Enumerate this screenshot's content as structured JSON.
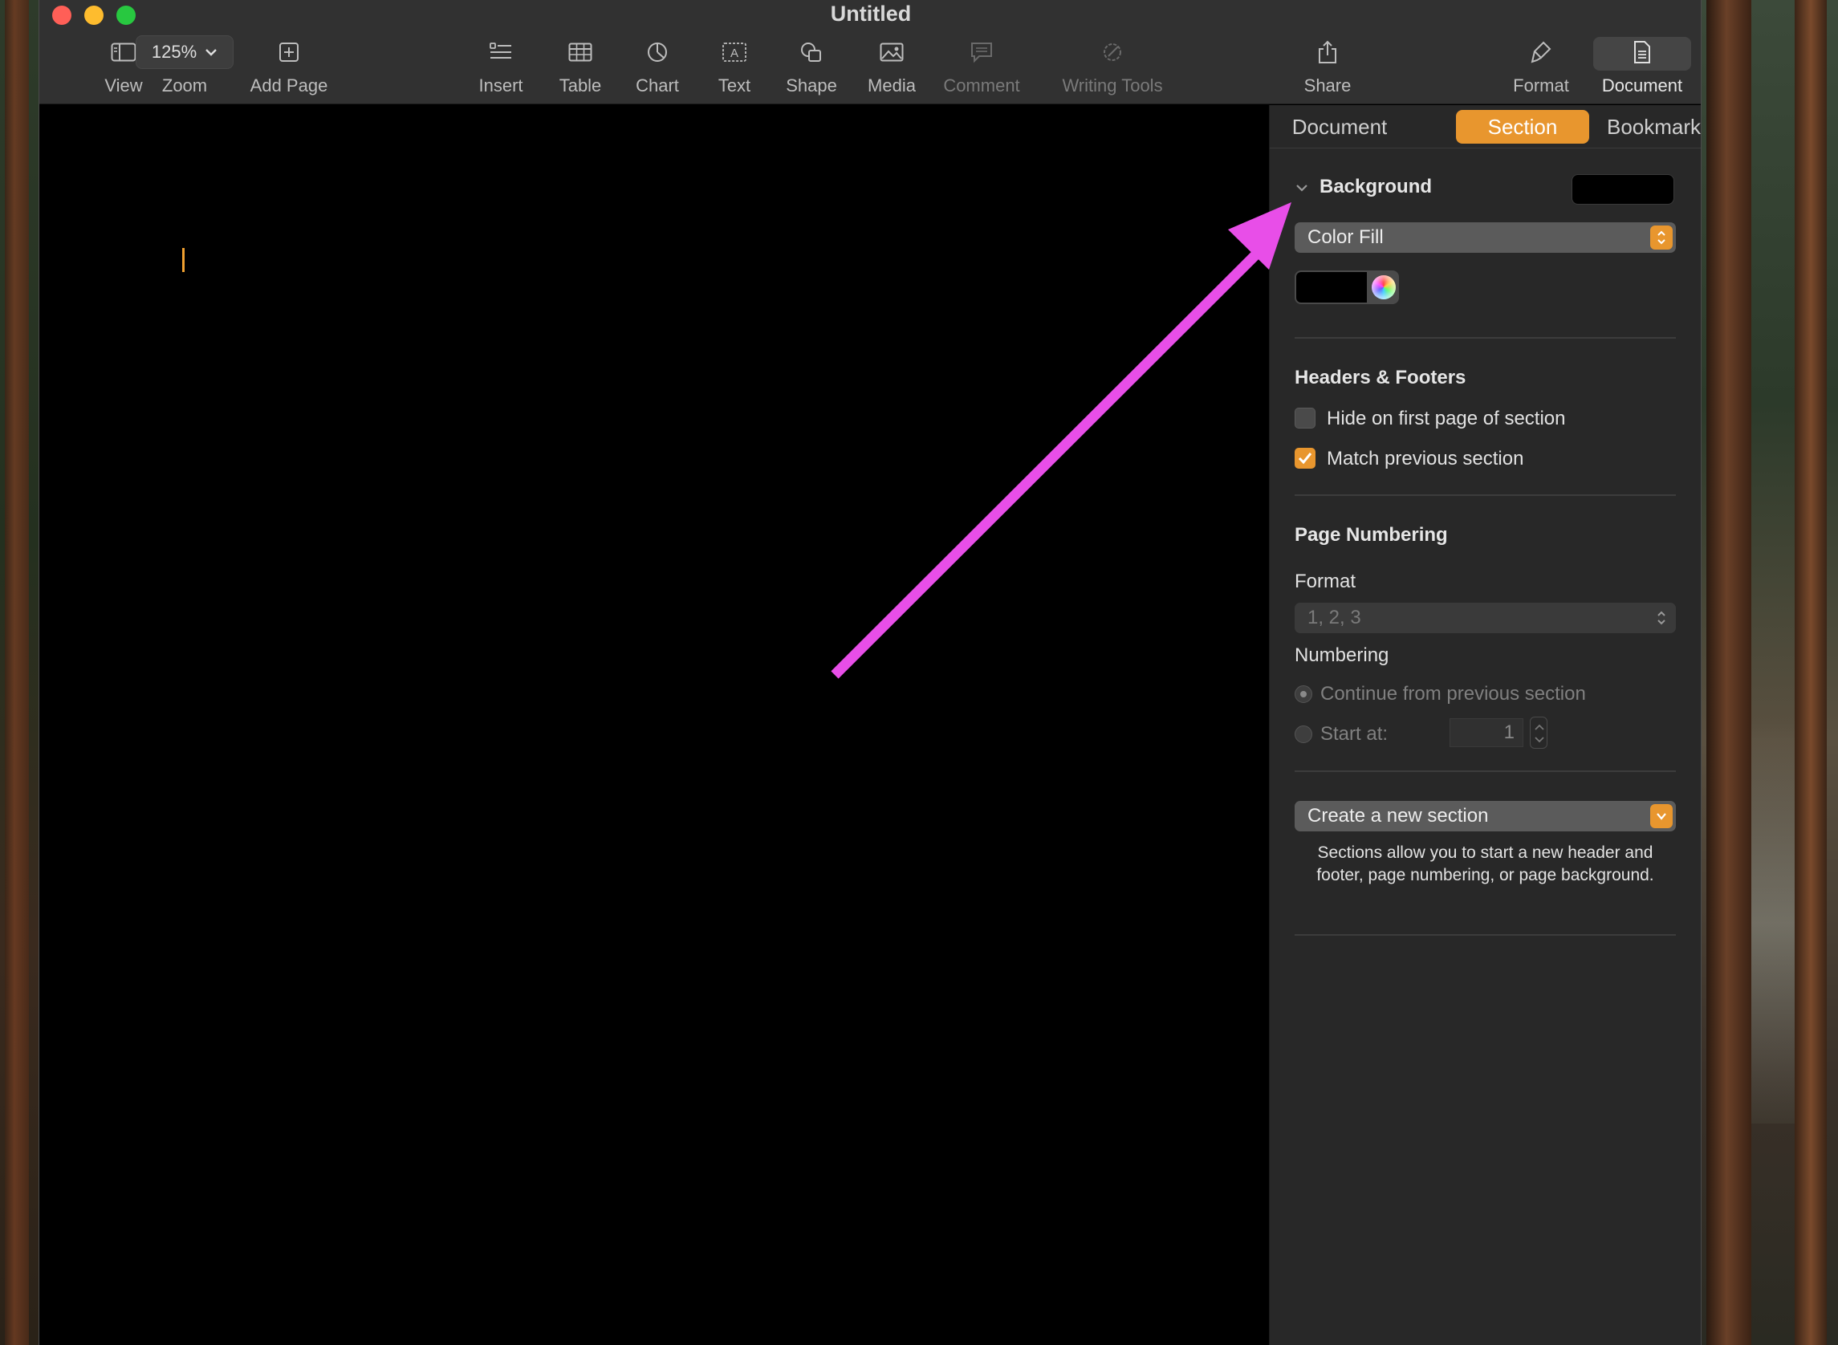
{
  "window": {
    "title": "Untitled"
  },
  "toolbar": {
    "view": "View",
    "zoom_value": "125%",
    "zoom": "Zoom",
    "add_page": "Add Page",
    "insert": "Insert",
    "table": "Table",
    "chart": "Chart",
    "text": "Text",
    "shape": "Shape",
    "media": "Media",
    "comment": "Comment",
    "writing_tools": "Writing Tools",
    "share": "Share",
    "format": "Format",
    "document": "Document"
  },
  "inspector": {
    "tabs": [
      "Document",
      "Section",
      "Bookmarks"
    ],
    "active_tab": "Section",
    "background": {
      "heading": "Background",
      "fill_type": "Color Fill",
      "fill_color": "#000000"
    },
    "headers_footers": {
      "heading": "Headers & Footers",
      "hide_first_page": {
        "label": "Hide on first page of section",
        "checked": false
      },
      "match_previous": {
        "label": "Match previous section",
        "checked": true
      }
    },
    "page_numbering": {
      "heading": "Page Numbering",
      "format_label": "Format",
      "format_value": "1, 2, 3",
      "numbering_label": "Numbering",
      "continue_label": "Continue from previous section",
      "start_at_label": "Start at:",
      "start_at_value": "1"
    },
    "create_section": "Create a new section",
    "help_text": "Sections allow you to start a new header and footer, page numbering, or page background."
  },
  "colors": {
    "accent": "#e8962e",
    "annotation_arrow": "#e84ee8"
  }
}
